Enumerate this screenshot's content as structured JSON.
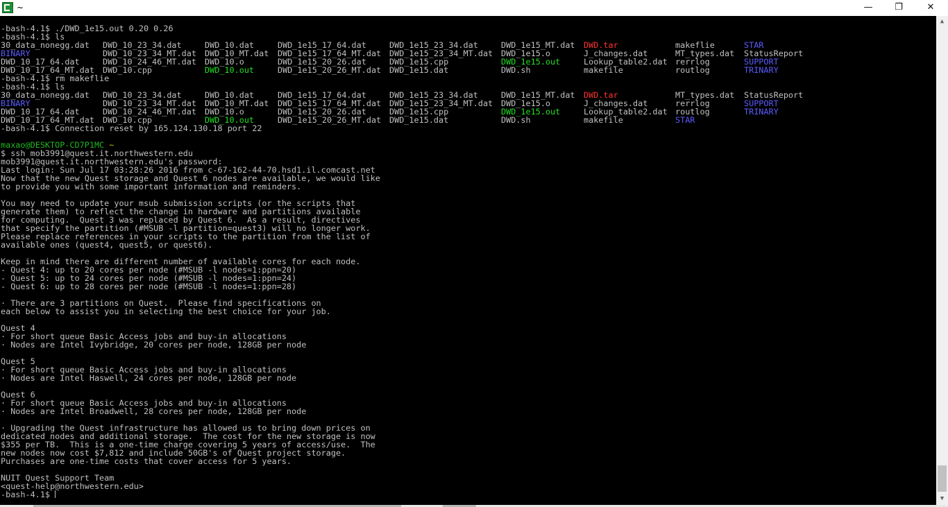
{
  "window": {
    "title": "~",
    "icon": "cygwin-terminal-icon",
    "minimize": "—",
    "maximize": "❐",
    "close": "✕"
  },
  "colors": {
    "text": "#c0c0c0",
    "directory": "#5b5bff",
    "executable": "#22e022",
    "archive": "#ff3030",
    "prompt_user": "#20b820",
    "prompt_path": "#c8b800"
  },
  "terminal": {
    "cmd1": "-bash-4.1$ ./DWD_1e15.out 0.20 0.26",
    "cmd2": "-bash-4.1$ ls",
    "ls1": [
      [
        "30_data_nonegg.dat",
        "DWD_10_23_34.dat",
        "DWD_10.dat",
        "DWD_1e15_17_64.dat",
        "DWD_1e15_23_34.dat",
        "DWD_1e15_MT.dat",
        "DWD.tar",
        "makeflie",
        "STAR"
      ],
      [
        "BINARY",
        "DWD_10_23_34_MT.dat",
        "DWD_10_MT.dat",
        "DWD_1e15_17_64_MT.dat",
        "DWD_1e15_23_34_MT.dat",
        "DWD_1e15.o",
        "J_changes.dat",
        "MT_types.dat",
        "StatusReport"
      ],
      [
        "DWD_10_17_64.dat",
        "DWD_10_24_46_MT.dat",
        "DWD_10.o",
        "DWD_1e15_20_26.dat",
        "DWD_1e15.cpp",
        "DWD_1e15.out",
        "Lookup_table2.dat",
        "rerrlog",
        "SUPPORT"
      ],
      [
        "DWD_10_17_64_MT.dat",
        "DWD_10.cpp",
        "DWD_10.out",
        "DWD_1e15_20_26_MT.dat",
        "DWD_1e15.dat",
        "DWD.sh",
        "makefile",
        "routlog",
        "TRINARY"
      ]
    ],
    "cmd3": "-bash-4.1$ rm makeflie",
    "cmd4": "-bash-4.1$ ls",
    "ls2": [
      [
        "30_data_nonegg.dat",
        "DWD_10_23_34.dat",
        "DWD_10.dat",
        "DWD_1e15_17_64.dat",
        "DWD_1e15_23_34.dat",
        "DWD_1e15_MT.dat",
        "DWD.tar",
        "MT_types.dat",
        "StatusReport"
      ],
      [
        "BINARY",
        "DWD_10_23_34_MT.dat",
        "DWD_10_MT.dat",
        "DWD_1e15_17_64_MT.dat",
        "DWD_1e15_23_34_MT.dat",
        "DWD_1e15.o",
        "J_changes.dat",
        "rerrlog",
        "SUPPORT"
      ],
      [
        "DWD_10_17_64.dat",
        "DWD_10_24_46_MT.dat",
        "DWD_10.o",
        "DWD_1e15_20_26.dat",
        "DWD_1e15.cpp",
        "DWD_1e15.out",
        "Lookup_table2.dat",
        "routlog",
        "TRINARY"
      ],
      [
        "DWD_10_17_64_MT.dat",
        "DWD_10.cpp",
        "DWD_10.out",
        "DWD_1e15_20_26_MT.dat",
        "DWD_1e15.dat",
        "DWD.sh",
        "makefile",
        "STAR",
        ""
      ]
    ],
    "conn_reset": "-bash-4.1$ Connection reset by 165.124.130.18 port 22",
    "local_user": "maxao@DESKTOP-CD7P1MC",
    "local_path": "~",
    "ssh_cmd": "$ ssh mob3991@quest.it.northwestern.edu",
    "motd": [
      "mob3991@quest.it.northwestern.edu's password:",
      "Last login: Sun Jul 17 03:28:26 2016 from c-67-162-44-70.hsd1.il.comcast.net",
      "Now that the new Quest storage and Quest 6 nodes are available, we would like",
      "to provide you with some important information and reminders.",
      "",
      "You may need to update your msub submission scripts (or the scripts that",
      "generate them) to reflect the change in hardware and partitions available",
      "for computing.  Quest 3 was replaced by Quest 6.  As a result, directives",
      "that specify the partition (#MSUB -l partition=quest3) will no longer work.",
      "Please replace references in your scripts to the partition from the list of",
      "available ones (quest4, quest5, or quest6).",
      "",
      "Keep in mind there are different number of available cores for each node.",
      "- Quest 4: up to 20 cores per node (#MSUB -l nodes=1:ppn=20)",
      "- Quest 5: up to 24 cores per node (#MSUB -l nodes=1:ppn=24)",
      "- Quest 6: up to 28 cores per node (#MSUB -l nodes=1:ppn=28)",
      "",
      "· There are 3 partitions on Quest.  Please find specifications on",
      "each below to assist you in selecting the best choice for your job.",
      "",
      "Quest 4",
      "· For short queue Basic Access jobs and buy-in allocations",
      "· Nodes are Intel Ivybridge, 20 cores per node, 128GB per node",
      "",
      "Quest 5",
      "· For short queue Basic Access jobs and buy-in allocations",
      "· Nodes are Intel Haswell, 24 cores per node, 128GB per node",
      "",
      "Quest 6",
      "· For short queue Basic Access jobs and buy-in allocations",
      "· Nodes are Intel Broadwell, 28 cores per node, 128GB per node",
      "",
      "· Upgrading the Quest infrastructure has allowed us to bring down prices on",
      "dedicated nodes and additional storage.  The cost for the new storage is now",
      "$355 per TB.  This is a one-time charge covering 5 years of access/use.  The",
      "new nodes now cost $7,812 and include 50GB's of Quest project storage.",
      "Purchases are one-time costs that cover access for 5 years.",
      "",
      "NUIT Quest Support Team",
      "<quest-help@northwestern.edu>"
    ],
    "final_prompt": "-bash-4.1$ "
  }
}
